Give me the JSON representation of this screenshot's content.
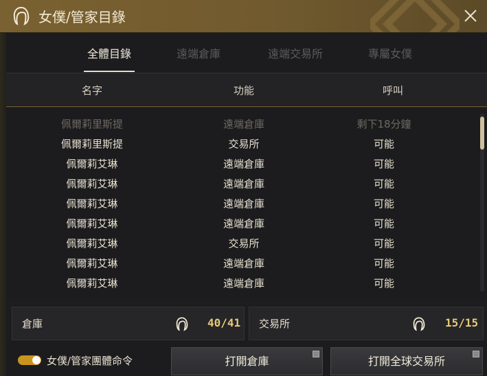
{
  "window": {
    "title": "女僕/管家目錄",
    "close_icon": "close-icon",
    "title_icon": "maid-hair-icon",
    "accent": "#7a6131"
  },
  "tabs": [
    {
      "label": "全體目錄",
      "active": true
    },
    {
      "label": "遠端倉庫",
      "active": false
    },
    {
      "label": "遠端交易所",
      "active": false
    },
    {
      "label": "專屬女僕",
      "active": false
    }
  ],
  "columns": {
    "name": "名字",
    "function": "功能",
    "call": "呼叫"
  },
  "rows": [
    {
      "name": "佩爾莉里斯提",
      "function": "遠端倉庫",
      "call": "剩下18分鐘",
      "dim": true
    },
    {
      "name": "佩爾莉里斯提",
      "function": "交易所",
      "call": "可能",
      "dim": false
    },
    {
      "name": "佩爾莉艾琳",
      "function": "遠端倉庫",
      "call": "可能",
      "dim": false
    },
    {
      "name": "佩爾莉艾琳",
      "function": "遠端倉庫",
      "call": "可能",
      "dim": false
    },
    {
      "name": "佩爾莉艾琳",
      "function": "遠端倉庫",
      "call": "可能",
      "dim": false
    },
    {
      "name": "佩爾莉艾琳",
      "function": "遠端倉庫",
      "call": "可能",
      "dim": false
    },
    {
      "name": "佩爾莉艾琳",
      "function": "交易所",
      "call": "可能",
      "dim": false
    },
    {
      "name": "佩爾莉艾琳",
      "function": "遠端倉庫",
      "call": "可能",
      "dim": false
    },
    {
      "name": "佩爾莉艾琳",
      "function": "遠端倉庫",
      "call": "可能",
      "dim": false
    }
  ],
  "storage": {
    "warehouse": {
      "label": "倉庫",
      "count": "40/41"
    },
    "market": {
      "label": "交易所",
      "count": "15/15"
    }
  },
  "footer": {
    "toggle_label": "女僕/管家團體命令",
    "toggle_on": true,
    "open_warehouse": "打開倉庫",
    "open_market": "打開全球交易所"
  }
}
